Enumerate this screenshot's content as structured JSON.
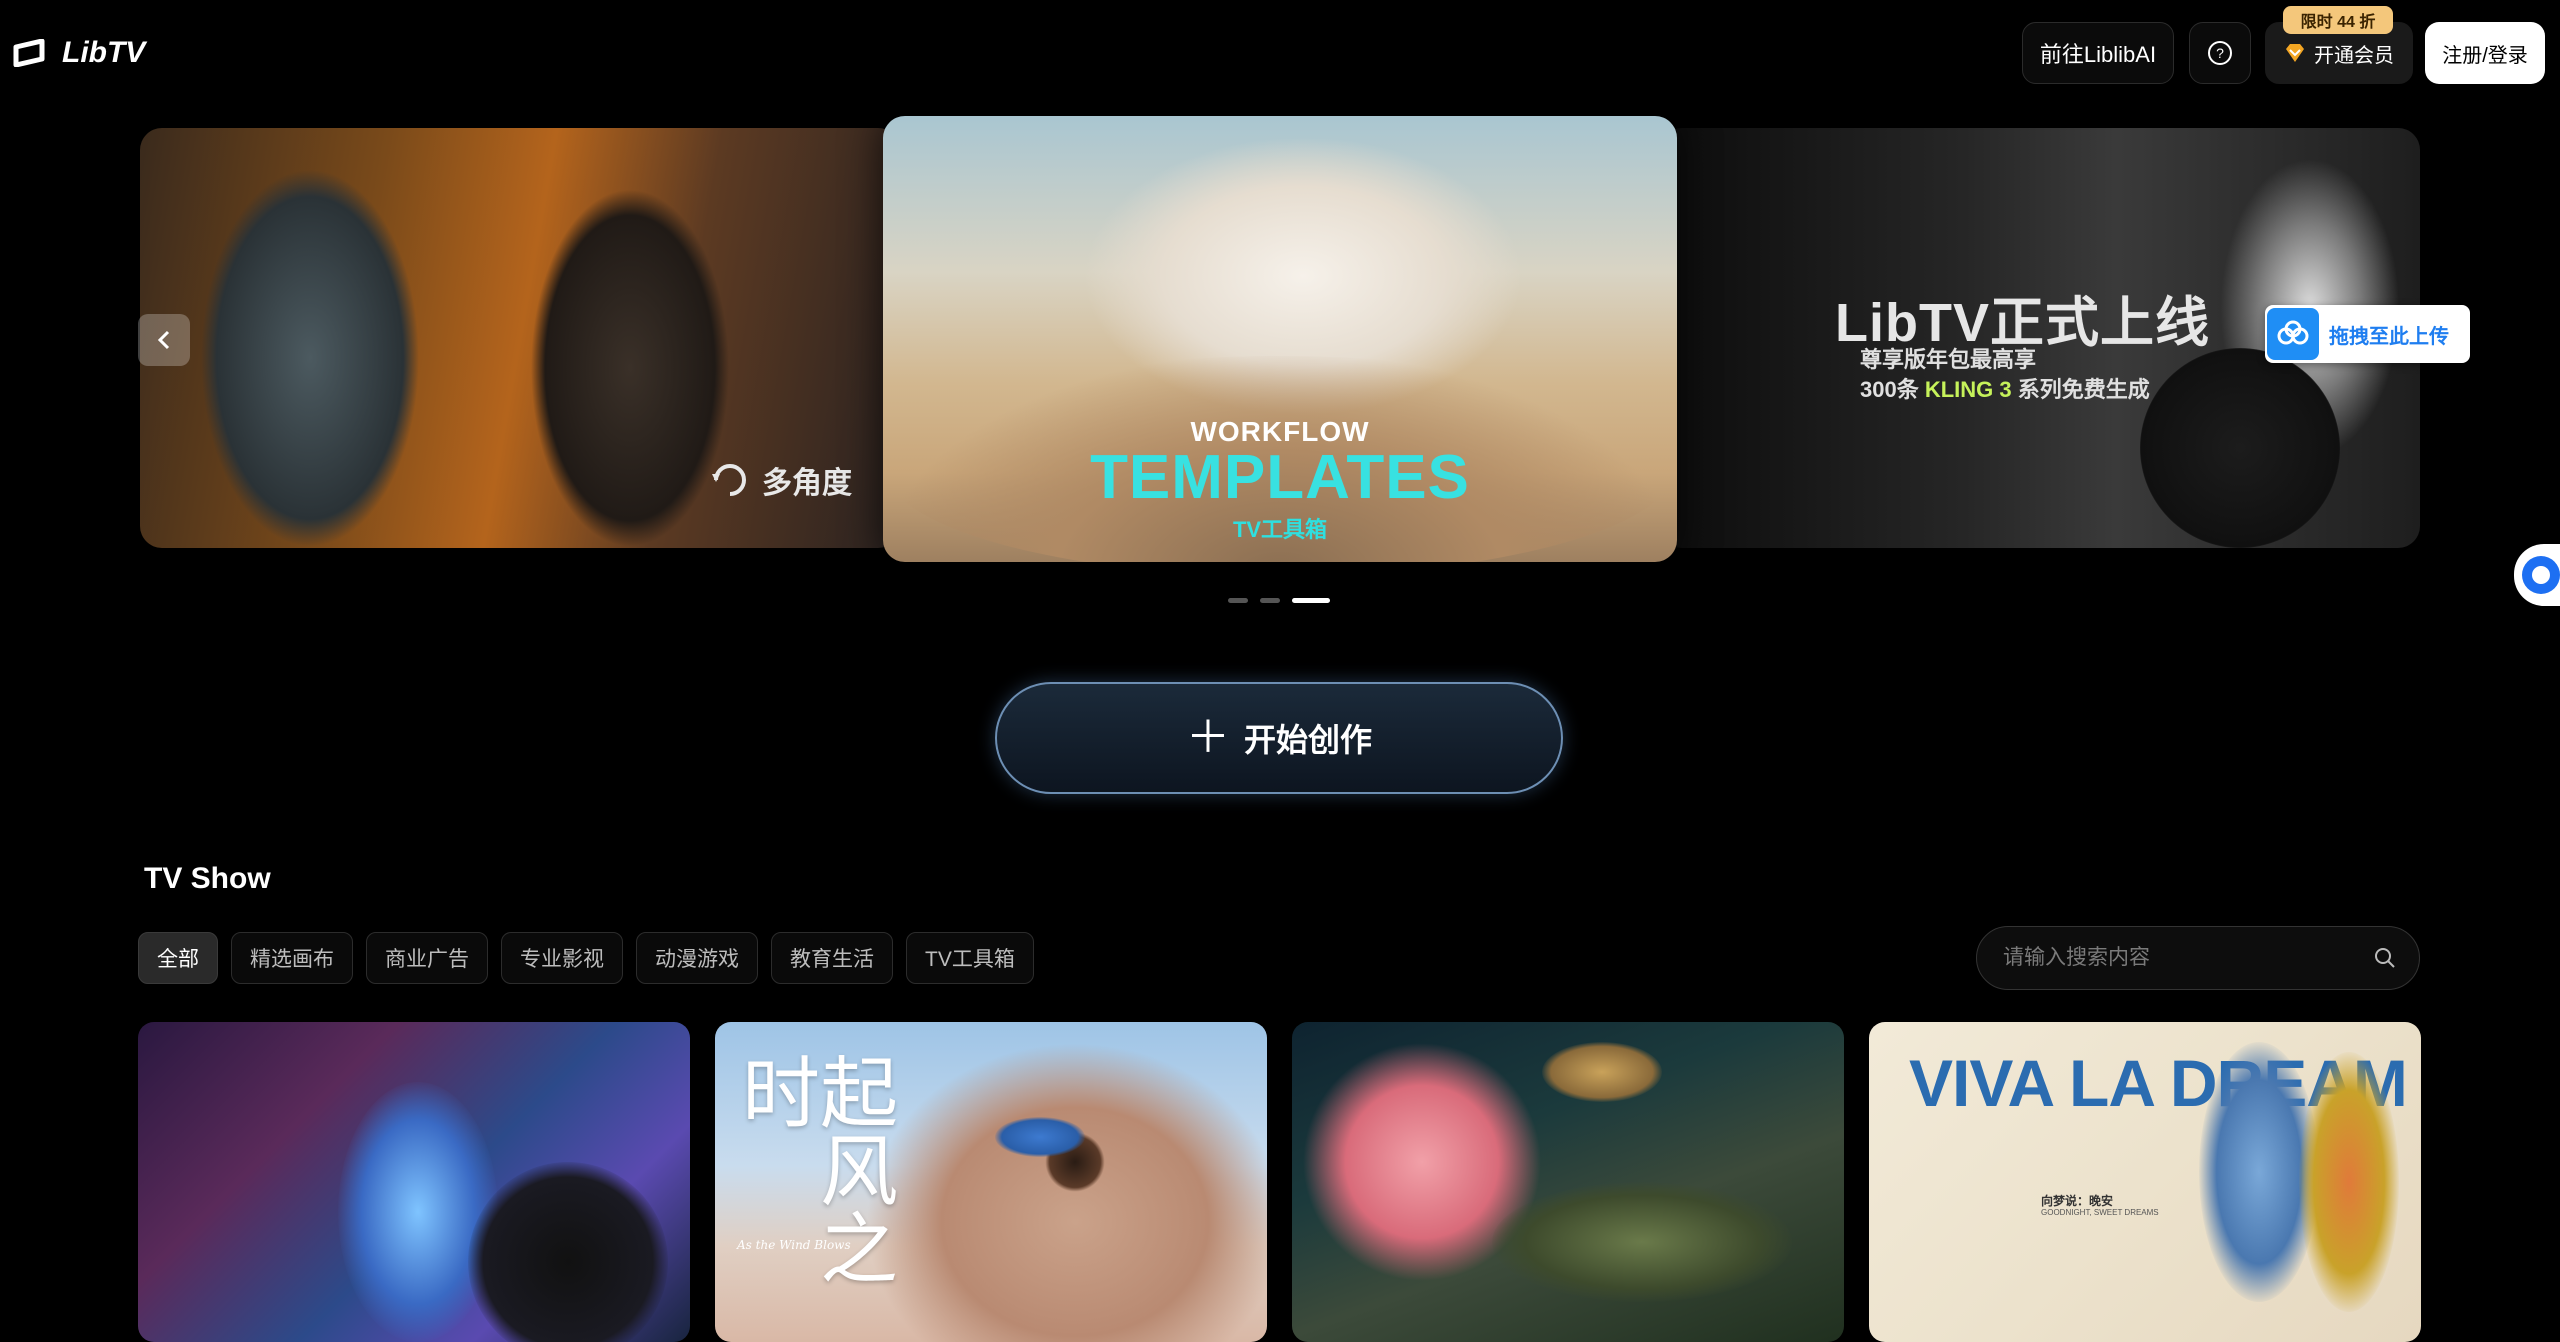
{
  "header": {
    "logo_text": "LibTV",
    "go_label": "前往LiblibAI",
    "vip_badge": "限时 44 折",
    "vip_label": "开通会员",
    "login_label": "注册/登录"
  },
  "carousel": {
    "center_title_top": "WORKFLOW",
    "center_title_main": "TEMPLATES",
    "center_title_sub": "TV工具箱",
    "right_title": "LibTV正式上线",
    "right_sub1": "尊享版年包最高享",
    "right_sub2_pre": "300条",
    "right_sub2_kling": "KLING 3",
    "right_sub2_post": "系列免费生成",
    "left_caption": "多角度",
    "upload_label": "拖拽至此上传",
    "active_index": 2,
    "dot_count": 3
  },
  "create_button": {
    "label": "开始创作"
  },
  "tv_show": {
    "title": "TV Show",
    "tabs": [
      "全部",
      "精选画布",
      "商业广告",
      "专业影视",
      "动漫游戏",
      "教育生活",
      "TV工具箱"
    ],
    "active_tab": 0,
    "search_placeholder": "请输入搜索内容",
    "cards": [
      {
        "title": ""
      },
      {
        "title": "起风之时",
        "subtitle": "As the Wind Blows"
      },
      {
        "title": ""
      },
      {
        "title": "VIVA LA DREAM",
        "subtitle_cn": "向梦说：晚安",
        "subtitle_en": "GOODNIGHT, SWEET DREAMS"
      }
    ]
  },
  "colors": {
    "accent_cyan": "#38e1e1",
    "vip_gold": "#f4c77b",
    "upload_blue": "#1f8ef5"
  }
}
